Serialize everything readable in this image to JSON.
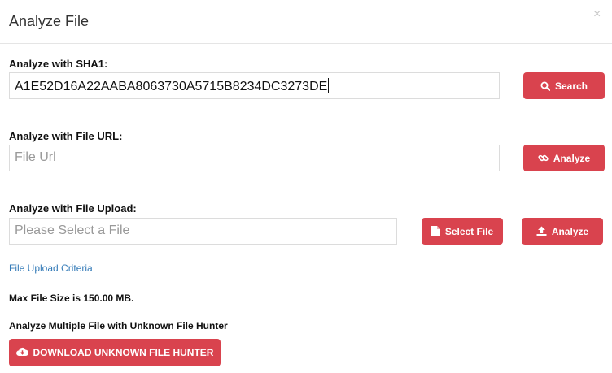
{
  "dialog": {
    "title": "Analyze File",
    "close_glyph": "×"
  },
  "sha1": {
    "label": "Analyze with SHA1:",
    "value": "A1E52D16A22AABA8063730A5715B8234DC3273DE",
    "button_label": "Search",
    "button_icon": "search-icon"
  },
  "url": {
    "label": "Analyze with File URL:",
    "placeholder": "File Url",
    "button_label": "Analyze",
    "button_icon": "link-icon"
  },
  "upload": {
    "label": "Analyze with File Upload:",
    "placeholder": "Please Select a File",
    "select_button_label": "Select File",
    "select_button_icon": "file-icon",
    "analyze_button_label": "Analyze",
    "analyze_button_icon": "upload-icon"
  },
  "criteria": {
    "link_text": "File Upload Criteria",
    "max_size_text": "Max File Size is 150.00 MB.",
    "multi_text": "Analyze Multiple File with Unknown File Hunter",
    "download_button_label": "DOWNLOAD UNKNOWN FILE HUNTER",
    "download_button_icon": "cloud-download-icon"
  },
  "colors": {
    "button_red": "#d9434e",
    "link_blue": "#337ab7"
  }
}
